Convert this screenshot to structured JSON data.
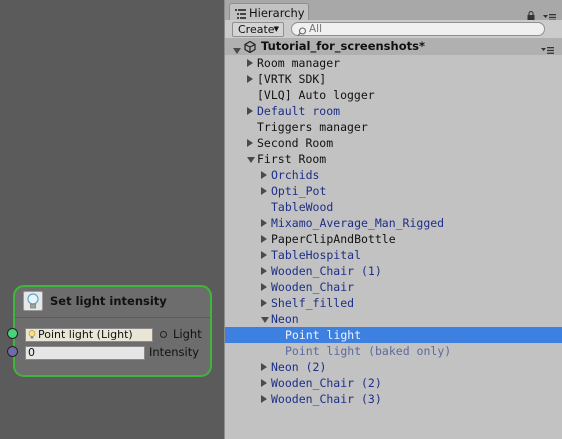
{
  "node": {
    "title": "Set light intensity",
    "light_field_value": "Point light (Light)",
    "light_label": "Light",
    "intensity_value": "0",
    "intensity_label": "Intensity",
    "border_color": "#3fb53c"
  },
  "hierarchy": {
    "tab_label": "Hierarchy",
    "create_label": "Create",
    "search_placeholder": "All",
    "scene_name": "Tutorial_for_screenshots*",
    "items": [
      {
        "label": "Room manager",
        "depth": 0,
        "arrow": "right",
        "style": "normal"
      },
      {
        "label": "[VRTK SDK]",
        "depth": 0,
        "arrow": "right",
        "style": "normal"
      },
      {
        "label": "[VLQ] Auto logger",
        "depth": 0,
        "arrow": "none",
        "style": "normal"
      },
      {
        "label": "Default room",
        "depth": 0,
        "arrow": "right",
        "style": "blue"
      },
      {
        "label": "Triggers manager",
        "depth": 0,
        "arrow": "none",
        "style": "normal"
      },
      {
        "label": "Second Room",
        "depth": 0,
        "arrow": "right",
        "style": "normal"
      },
      {
        "label": "First Room",
        "depth": 0,
        "arrow": "down",
        "style": "normal"
      },
      {
        "label": "Orchids",
        "depth": 1,
        "arrow": "right",
        "style": "blue"
      },
      {
        "label": "Opti_Pot",
        "depth": 1,
        "arrow": "right",
        "style": "blue"
      },
      {
        "label": "TableWood",
        "depth": 1,
        "arrow": "none",
        "style": "blue"
      },
      {
        "label": "Mixamo_Average_Man_Rigged",
        "depth": 1,
        "arrow": "right",
        "style": "blue"
      },
      {
        "label": "PaperClipAndBottle",
        "depth": 1,
        "arrow": "right",
        "style": "normal"
      },
      {
        "label": "TableHospital",
        "depth": 1,
        "arrow": "right",
        "style": "blue"
      },
      {
        "label": "Wooden_Chair (1)",
        "depth": 1,
        "arrow": "right",
        "style": "blue"
      },
      {
        "label": "Wooden_Chair",
        "depth": 1,
        "arrow": "right",
        "style": "blue"
      },
      {
        "label": "Shelf_filled",
        "depth": 1,
        "arrow": "right",
        "style": "blue"
      },
      {
        "label": "Neon",
        "depth": 1,
        "arrow": "down",
        "style": "blue"
      },
      {
        "label": "Point light",
        "depth": 2,
        "arrow": "none",
        "style": "selected"
      },
      {
        "label": "Point light (baked only)",
        "depth": 2,
        "arrow": "none",
        "style": "muted"
      },
      {
        "label": "Neon (2)",
        "depth": 1,
        "arrow": "right",
        "style": "blue"
      },
      {
        "label": "Wooden_Chair (2)",
        "depth": 1,
        "arrow": "right",
        "style": "blue"
      },
      {
        "label": "Wooden_Chair (3)",
        "depth": 1,
        "arrow": "right",
        "style": "blue"
      }
    ]
  },
  "icons": {
    "node_icon": "lightbulb-icon",
    "tab_icon": "hierarchy-list-icon",
    "lock": "lock-icon",
    "tab_menu": "context-menu-icon",
    "search": "search-icon",
    "scene": "unity-logo-icon",
    "scene_menu": "context-menu-icon"
  }
}
